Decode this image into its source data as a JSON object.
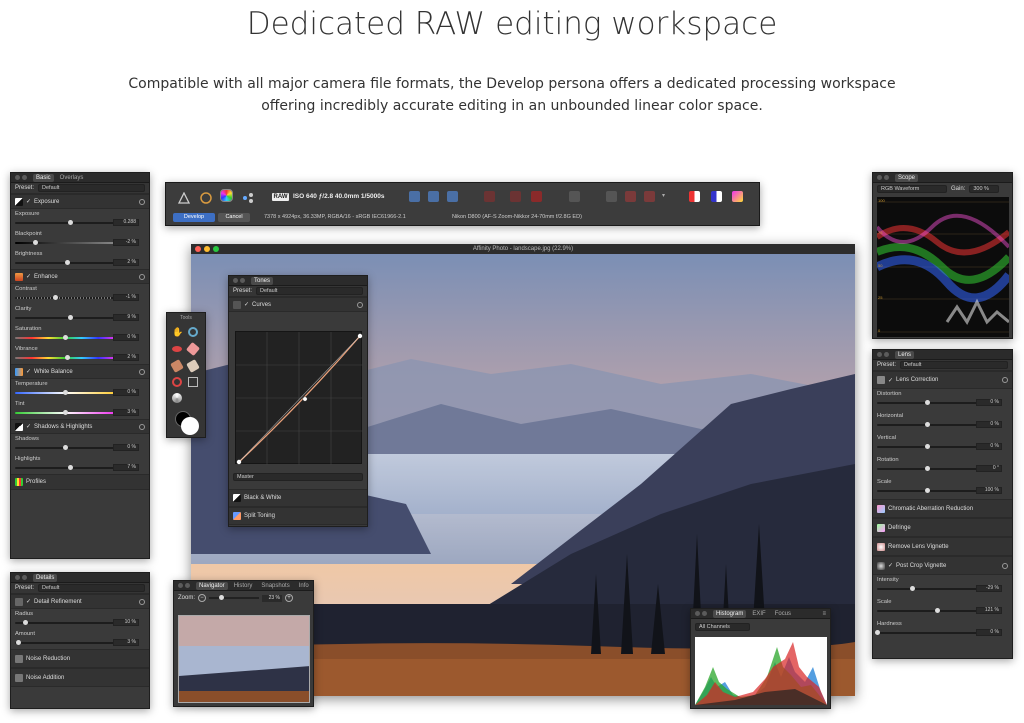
{
  "hero": {
    "title": "Dedicated RAW editing workspace",
    "subtitle": "Compatible with all major camera file formats, the Develop persona offers a dedicated processing workspace offering incredibly accurate editing in an unbounded linear color space."
  },
  "basic_panel": {
    "tabs": [
      "Basic",
      "Overlays"
    ],
    "preset_label": "Preset:",
    "preset_value": "Default",
    "sections": {
      "exposure": "Exposure",
      "enhance": "Enhance",
      "white_balance": "White Balance",
      "shadows_highlights": "Shadows & Highlights",
      "profiles": "Profiles"
    },
    "controls": {
      "exposure": {
        "label": "Exposure",
        "value": "0.288",
        "level": 0.55
      },
      "blackpoint": {
        "label": "Blackpoint",
        "value": "-2 %",
        "level": 0.2
      },
      "brightness": {
        "label": "Brightness",
        "value": "2 %",
        "level": 0.52
      },
      "contrast": {
        "label": "Contrast",
        "value": "-1 %",
        "level": 0.4
      },
      "clarity": {
        "label": "Clarity",
        "value": "9 %",
        "level": 0.55
      },
      "saturation": {
        "label": "Saturation",
        "value": "0 %",
        "level": 0.5
      },
      "vibrance": {
        "label": "Vibrance",
        "value": "2 %",
        "level": 0.52
      },
      "temperature": {
        "label": "Temperature",
        "value": "0 %",
        "level": 0.5
      },
      "tint": {
        "label": "Tint",
        "value": "3 %",
        "level": 0.5
      },
      "shadows": {
        "label": "Shadows",
        "value": "0 %",
        "level": 0.5
      },
      "highlights": {
        "label": "Highlights",
        "value": "7 %",
        "level": 0.55
      }
    }
  },
  "details_panel": {
    "tab": "Details",
    "preset_label": "Preset:",
    "preset_value": "Default",
    "detail_refinement": "Detail Refinement",
    "radius": {
      "label": "Radius",
      "value": "10 %",
      "level": 0.1
    },
    "amount": {
      "label": "Amount",
      "value": "3 %",
      "level": 0.03
    },
    "noise_reduction": "Noise Reduction",
    "noise_addition": "Noise Addition"
  },
  "toolbar": {
    "raw_badge": "RAW",
    "exif": "ISO 640 ƒ/2.8 40.0mm 1/5000s",
    "develop": "Develop",
    "cancel": "Cancel",
    "file_info": "7378 x 4924px, 36.33MP, RGBA/16 - sRGB IEC61966-2.1",
    "camera_info": "Nikon D800 (AF-S Zoom-Nikkor 24-70mm f/2.8G ED)"
  },
  "window": {
    "title": "Affinity Photo - landscape.jpg (22.9%)"
  },
  "tools": {
    "title": "Tools"
  },
  "tones_panel": {
    "tab": "Tones",
    "preset_label": "Preset:",
    "preset_value": "Default",
    "curves": "Curves",
    "channel": "Master",
    "black_white": "Black & White",
    "split_toning": "Split Toning"
  },
  "navigator_panel": {
    "tabs": [
      "Navigator",
      "History",
      "Snapshots",
      "Info"
    ],
    "zoom_label": "Zoom:",
    "zoom_value": "23 %"
  },
  "histogram_panel": {
    "tabs": [
      "Histogram",
      "EXIF",
      "Focus"
    ],
    "channel": "All Channels"
  },
  "scope_panel": {
    "tab": "Scope",
    "mode": "RGB Waveform",
    "gain_label": "Gain:",
    "gain_value": "300 %",
    "scale": [
      "100",
      "75",
      "50",
      "25",
      "0"
    ]
  },
  "lens_panel": {
    "tab": "Lens",
    "preset_label": "Preset:",
    "preset_value": "Default",
    "lens_correction": "Lens Correction",
    "controls": {
      "distortion": {
        "label": "Distortion",
        "value": "0 %",
        "level": 0.5
      },
      "horizontal": {
        "label": "Horizontal",
        "value": "0 %",
        "level": 0.5
      },
      "vertical": {
        "label": "Vertical",
        "value": "0 %",
        "level": 0.5
      },
      "rotation": {
        "label": "Rotation",
        "value": "0 °",
        "level": 0.5
      },
      "scale": {
        "label": "Scale",
        "value": "100 %",
        "level": 0.5
      },
      "intensity": {
        "label": "Intensity",
        "value": "-29 %",
        "level": 0.35
      },
      "vignette_scale": {
        "label": "Scale",
        "value": "121 %",
        "level": 0.6
      },
      "hardness": {
        "label": "Hardness",
        "value": "0 %",
        "level": 0.0
      }
    },
    "chromatic": "Chromatic Aberration Reduction",
    "defringe": "Defringe",
    "remove_vignette": "Remove Lens Vignette",
    "post_crop": "Post Crop Vignette"
  }
}
